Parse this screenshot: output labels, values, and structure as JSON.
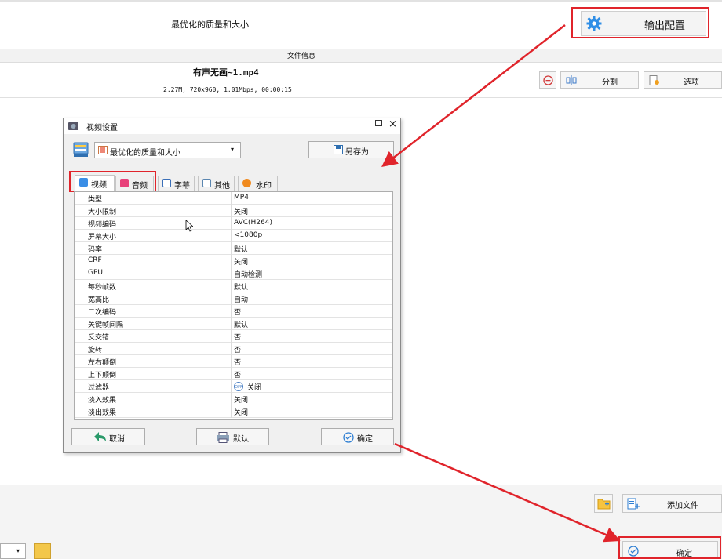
{
  "main": {
    "quality_text": "最优化的质量和大小",
    "output_config_label": "输出配置",
    "file_info_label": "文件信息",
    "file_name": "有声无画~1.mp4",
    "file_meta": "2.27M, 720x960, 1.01Mbps, 00:00:15",
    "split_label": "分割",
    "options_label": "选项",
    "add_file_label": "添加文件",
    "confirm_label": "确定"
  },
  "dialog": {
    "title": "视频设置",
    "preset_value": "最优化的质量和大小",
    "save_as_label": "另存为",
    "tabs": [
      {
        "label": "视频",
        "icon": "video-icon",
        "color": "#3a8ee6"
      },
      {
        "label": "音频",
        "icon": "music-icon",
        "color": "#e8417a"
      },
      {
        "label": "字幕",
        "icon": "subtitle-icon",
        "color": "#3a6fb8"
      },
      {
        "label": "其他",
        "icon": "other-icon",
        "color": "#5a86b0"
      },
      {
        "label": "水印",
        "icon": "watermark-icon",
        "color": "#f08a1e"
      }
    ],
    "rows": [
      {
        "key": "类型",
        "value": "MP4"
      },
      {
        "key": "大小限制",
        "value": "关闭"
      },
      {
        "key": "视频编码",
        "value": "AVC(H264)"
      },
      {
        "key": "屏幕大小",
        "value": "<1080p"
      },
      {
        "key": "码率",
        "value": "默认"
      },
      {
        "key": "CRF",
        "value": "关闭"
      },
      {
        "key": "GPU",
        "value": "自动检测"
      },
      {
        "key": "每秒帧数",
        "value": "默认"
      },
      {
        "key": "宽高比",
        "value": "自动"
      },
      {
        "key": "二次编码",
        "value": "否"
      },
      {
        "key": "关键帧间隔",
        "value": "默认"
      },
      {
        "key": "反交错",
        "value": "否"
      },
      {
        "key": "旋转",
        "value": "否"
      },
      {
        "key": "左右颠倒",
        "value": "否"
      },
      {
        "key": "上下颠倒",
        "value": "否"
      },
      {
        "key": "过滤器",
        "value": "关闭",
        "toggle": "OFF"
      },
      {
        "key": "淡入效果",
        "value": "关闭"
      },
      {
        "key": "淡出效果",
        "value": "关闭"
      }
    ],
    "cancel_label": "取消",
    "default_label": "默认",
    "ok_label": "确定"
  },
  "colors": {
    "annotation_red": "#e0242b",
    "accent_blue": "#2f7fd3"
  }
}
